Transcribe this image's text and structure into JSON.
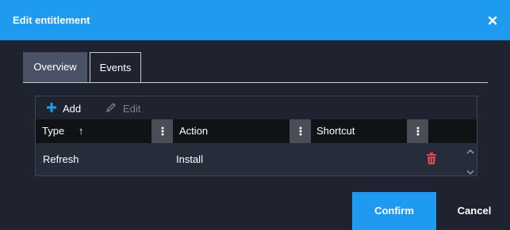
{
  "dialog": {
    "title": "Edit entitlement",
    "close_icon": "close-icon"
  },
  "tabs": [
    {
      "label": "Overview",
      "active": false
    },
    {
      "label": "Events",
      "active": true
    }
  ],
  "toolbar": {
    "add_label": "Add",
    "edit_label": "Edit",
    "add_icon": "plus-icon",
    "edit_icon": "pencil-icon"
  },
  "table": {
    "columns": [
      {
        "label": "Type",
        "sort_indicator": "↑"
      },
      {
        "label": "Action"
      },
      {
        "label": "Shortcut"
      }
    ],
    "rows": [
      {
        "type": "Refresh",
        "action": "Install",
        "shortcut": ""
      }
    ]
  },
  "footer": {
    "confirm_label": "Confirm",
    "cancel_label": "Cancel"
  },
  "colors": {
    "accent": "#1e9bf0",
    "background": "#1f2330",
    "delete": "#e0444f"
  }
}
